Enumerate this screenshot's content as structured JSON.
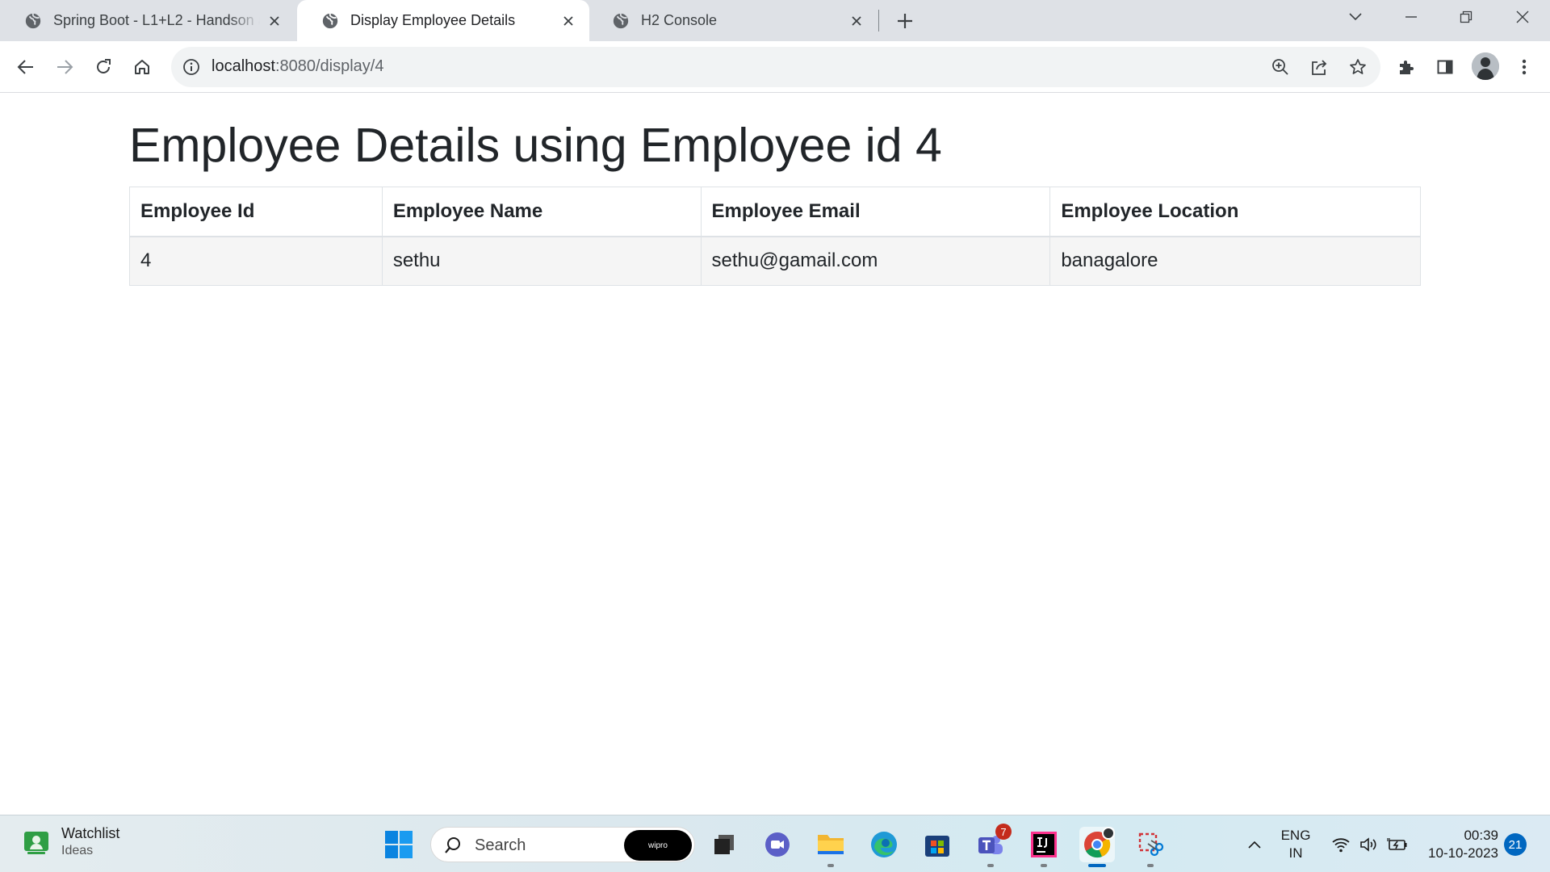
{
  "browser": {
    "tabs": [
      {
        "title": "Spring Boot - L1+L2 - Handson a",
        "active": false
      },
      {
        "title": "Display Employee Details",
        "active": true
      },
      {
        "title": "H2 Console",
        "active": false
      }
    ],
    "url": {
      "host": "localhost",
      "path": ":8080/display/4"
    }
  },
  "page": {
    "title": "Employee Details using Employee id 4",
    "table": {
      "headers": [
        "Employee Id",
        "Employee Name",
        "Employee Email",
        "Employee Location"
      ],
      "rows": [
        [
          "4",
          "sethu",
          "sethu@gamail.com",
          "banagalore"
        ]
      ]
    }
  },
  "taskbar": {
    "widget": {
      "title": "Watchlist",
      "subtitle": "Ideas"
    },
    "search": {
      "placeholder": "Search",
      "badge": "wipro"
    },
    "teams_badge": "7",
    "language": {
      "line1": "ENG",
      "line2": "IN"
    },
    "clock": {
      "time": "00:39",
      "date": "10-10-2023"
    },
    "notification_count": "21"
  }
}
